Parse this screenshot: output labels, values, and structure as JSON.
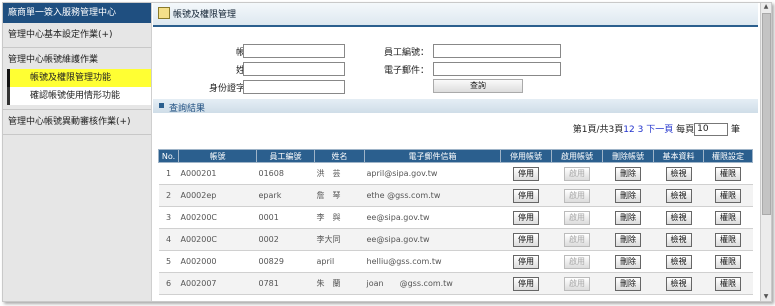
{
  "sidebar": {
    "title": "廠商單一簽入服務管理中心",
    "sec1": "管理中心基本設定作業(+)",
    "sec2": "管理中心帳號維護作業",
    "sub1": "帳號及權限管理功能",
    "sub2": "確認帳號使用情形功能",
    "sec3": "管理中心帳號異動審核作業(+)"
  },
  "header": {
    "title": "帳號及權限管理"
  },
  "form": {
    "account_label": "帳號：",
    "name_label": "姓名：",
    "id_label": "身份證字號：",
    "emp_label": "員工編號：",
    "email_label": "電子郵件：",
    "query_button": "查詢"
  },
  "results": {
    "title": "查詢結果"
  },
  "pager": {
    "info": "第1頁/共3頁",
    "p1": "1",
    "p2": "2",
    "p3": "3",
    "next": "下一頁",
    "per_page": "每頁",
    "per_page_value": "10",
    "unit": "筆"
  },
  "table": {
    "headers": [
      "No.",
      "帳號",
      "員工編號",
      "姓名",
      "電子郵件信箱",
      "停用帳號",
      "啟用帳號",
      "刪除帳號",
      "基本資料",
      "權限設定"
    ],
    "button_labels": {
      "disable": "停用",
      "enable": "啟用",
      "delete": "刪除",
      "view": "檢視",
      "perm": "權限"
    },
    "rows": [
      {
        "no": "1",
        "account": "A000201",
        "emp": "01608",
        "name": "洪　芸",
        "email": "april@sipa.gov.tw"
      },
      {
        "no": "2",
        "account": "A0002ep",
        "emp": "epark",
        "name": "詹　琴",
        "email": "ethe @gss.com.tw"
      },
      {
        "no": "3",
        "account": "A00200C",
        "emp": "0001",
        "name": "李　與",
        "email": "ee@sipa.gov.tw"
      },
      {
        "no": "4",
        "account": "A00200C",
        "emp": "0002",
        "name": "李大同",
        "email": "ee@sipa.gov.tw"
      },
      {
        "no": "5",
        "account": "A002000",
        "emp": "00829",
        "name": "april",
        "email": "helliu@gss.com.tw"
      },
      {
        "no": "6",
        "account": "A002007",
        "emp": "0781",
        "name": "朱　蘭",
        "email": "joan　　@gss.com.tw"
      }
    ]
  }
}
